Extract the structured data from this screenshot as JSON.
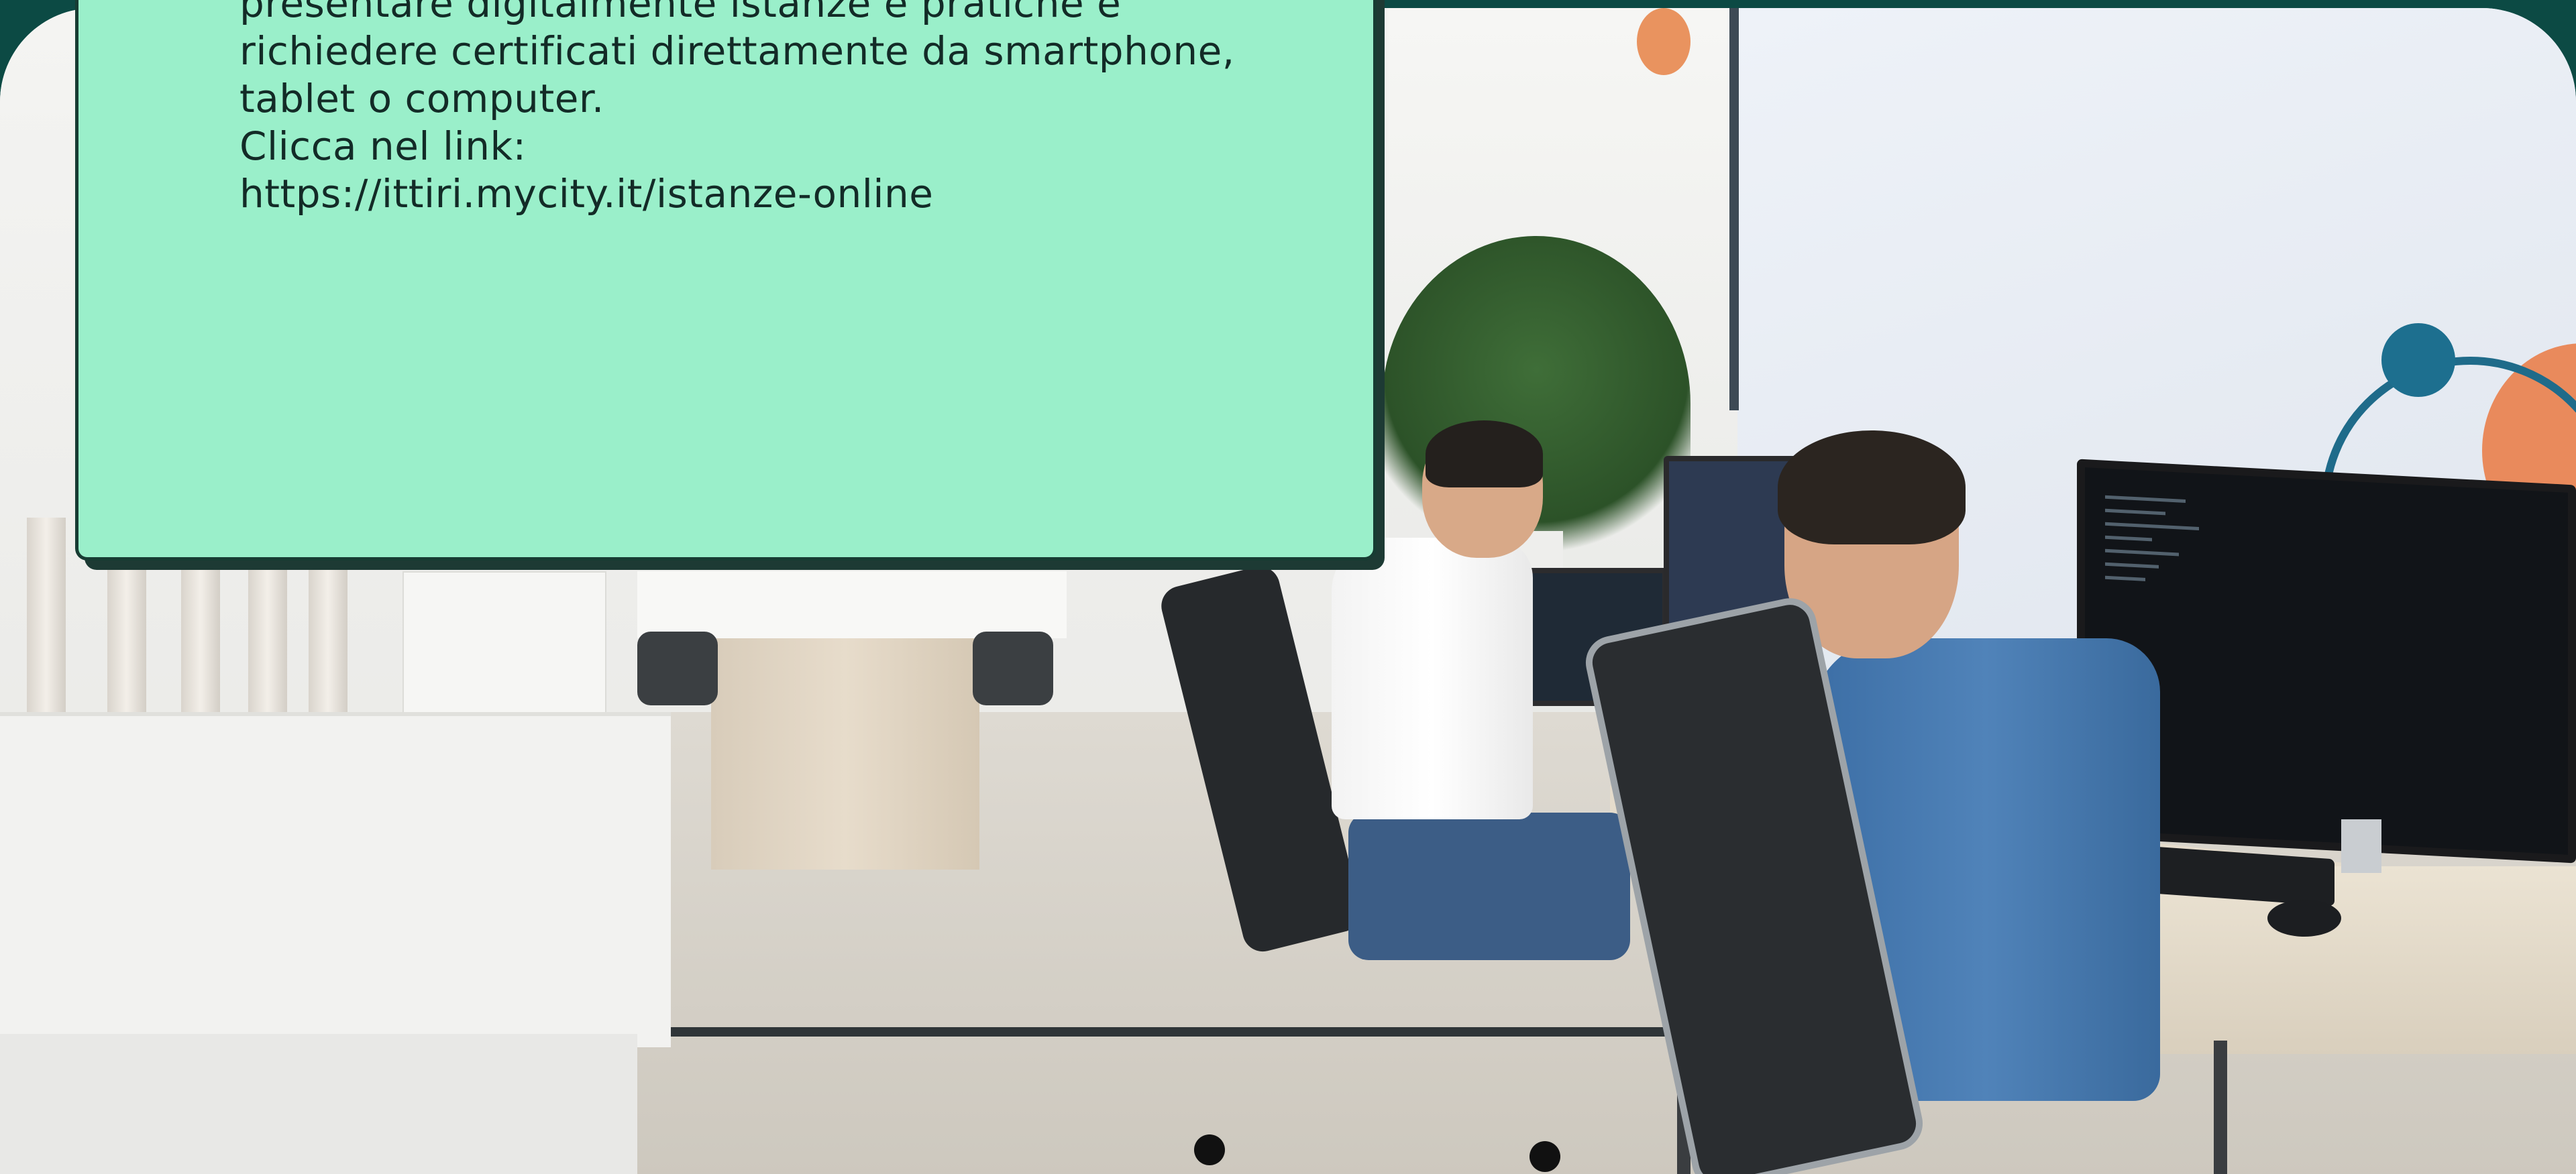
{
  "info_card": {
    "lines": [
      "presentare digitalmente istanze e pratiche e",
      "richiedere certificati direttamente da smartphone,",
      "tablet o computer.",
      "Clicca nel link:",
      "https://ittiri.mycity.it/istanze-online"
    ]
  },
  "colors": {
    "card_background": "#9aefca",
    "card_border": "#173c33",
    "frame_background": "#0c4a44",
    "text": "#132b27"
  }
}
